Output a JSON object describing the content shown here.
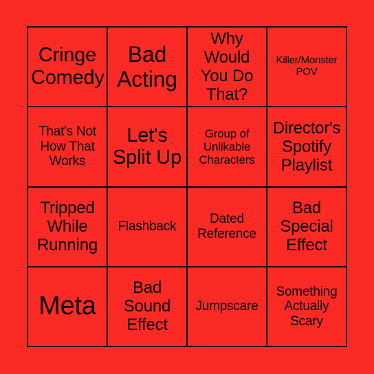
{
  "card": {
    "type": "bingo-card",
    "grid_size": "4x4",
    "background_color": "#fc2a25",
    "line_color": "#000000",
    "text_color": "#000000",
    "rows": [
      [
        {
          "text": "Cringe Comedy",
          "size": "lg"
        },
        {
          "text": "Bad Acting",
          "size": "xl"
        },
        {
          "text": "Why Would You Do That?",
          "size": "md"
        },
        {
          "text": "Killer/Monster POV",
          "size": "xxs"
        }
      ],
      [
        {
          "text": "That's Not How That Works",
          "size": "sm"
        },
        {
          "text": "Let's Split Up",
          "size": "lg"
        },
        {
          "text": "Group of Unlikable Characters",
          "size": "xs"
        },
        {
          "text": "Director's Spotify Playlist",
          "size": "md"
        }
      ],
      [
        {
          "text": "Tripped While Running",
          "size": "md"
        },
        {
          "text": "Flashback",
          "size": "sm"
        },
        {
          "text": "Dated Reference",
          "size": "sm"
        },
        {
          "text": "Bad Special Effect",
          "size": "md"
        }
      ],
      [
        {
          "text": "Meta",
          "size": "xxl"
        },
        {
          "text": "Bad Sound Effect",
          "size": "md"
        },
        {
          "text": "Jumpscare",
          "size": "sm"
        },
        {
          "text": "Something Actually Scary",
          "size": "sm"
        }
      ]
    ]
  }
}
